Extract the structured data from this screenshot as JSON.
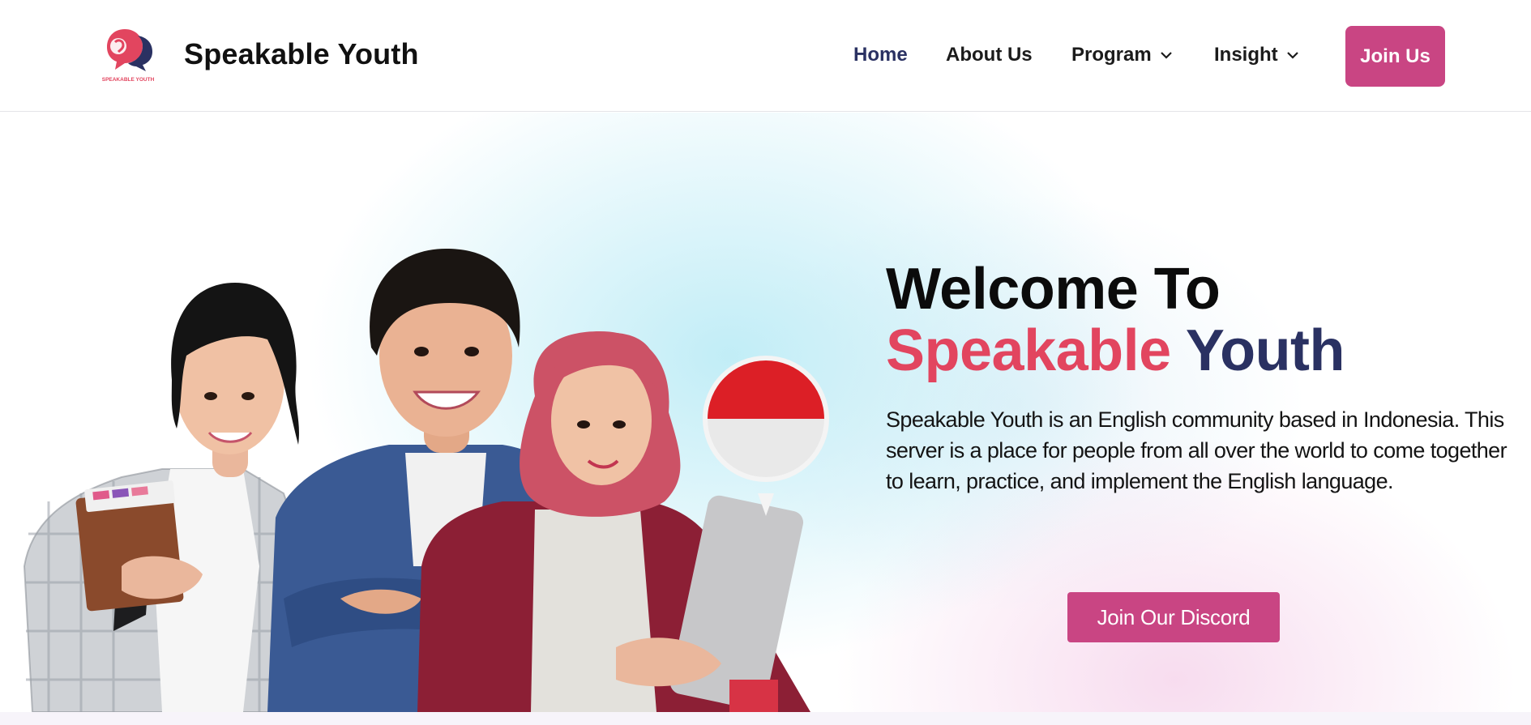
{
  "header": {
    "logo_text": "SPEAKABLE YOUTH",
    "site_title": "Speakable Youth",
    "nav": [
      {
        "label": "Home",
        "active": true
      },
      {
        "label": "About Us"
      },
      {
        "label": "Program",
        "dropdown": true
      },
      {
        "label": "Insight",
        "dropdown": true
      }
    ],
    "join_label": "Join Us"
  },
  "hero": {
    "headline_line1": "Welcome To",
    "headline_word1": "Speakable",
    "headline_word2": "Youth",
    "description": "Speakable Youth is an English community based in Indonesia. This server is a place for people from all over the world to come together to learn, practice, and implement the English language.",
    "discord_label": "Join Our Discord"
  },
  "icons": {
    "logo": "speakable-youth-logo",
    "chevron": "chevron-down-icon",
    "flag": "indonesia-flag-bubble"
  },
  "colors": {
    "accent_pink": "#c94583",
    "headline_pink": "#e2455f",
    "navy": "#2a3162",
    "flag_red": "#dc1f26"
  }
}
